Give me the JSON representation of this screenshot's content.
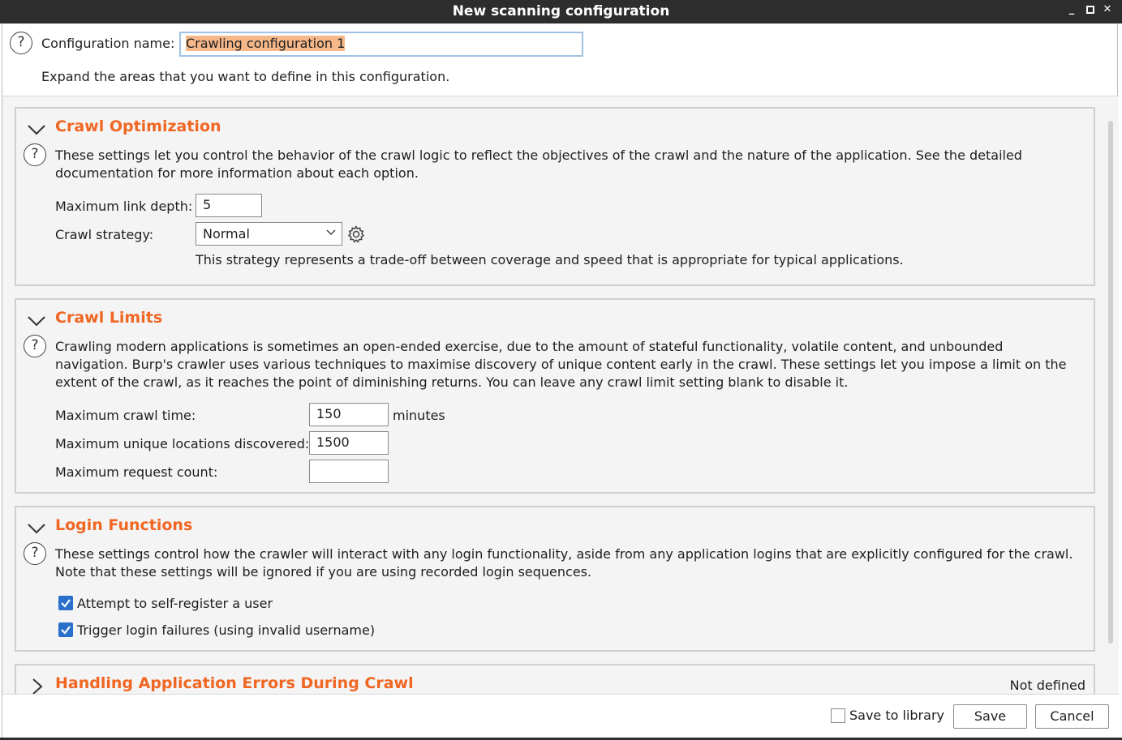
{
  "window": {
    "title": "New scanning configuration",
    "controls": {
      "minimize": "_",
      "maximize": "▫",
      "close": "✕"
    }
  },
  "config_name": {
    "label": "Configuration name:",
    "value": "Crawling configuration 1"
  },
  "intro": "Expand the areas that you want to define in this configuration.",
  "help_glyph": "?",
  "crawl_optimization": {
    "title": "Crawl Optimization",
    "description": "These settings let you control the behavior of the crawl logic to reflect the objectives of the crawl and the nature of the application. See the detailed documentation for more information about each option.",
    "max_link_depth_label": "Maximum link depth:",
    "max_link_depth_value": "5",
    "crawl_strategy_label": "Crawl strategy:",
    "crawl_strategy_value": "Normal",
    "strategy_note": "This strategy represents a trade-off between coverage and speed that is appropriate for typical applications."
  },
  "crawl_limits": {
    "title": "Crawl Limits",
    "description": "Crawling modern applications is sometimes an open-ended exercise, due to the amount of stateful functionality, volatile content, and unbounded navigation. Burp's crawler uses various techniques to maximise discovery of unique content early in the crawl. These settings let you impose a limit on the extent of the crawl, as it reaches the point of diminishing returns. You can leave any crawl limit setting blank to disable it.",
    "max_time_label": "Maximum crawl time:",
    "max_time_value": "150",
    "max_time_unit": "minutes",
    "max_locations_label": "Maximum unique locations discovered:",
    "max_locations_value": "1500",
    "max_requests_label": "Maximum request count:",
    "max_requests_value": ""
  },
  "login_functions": {
    "title": "Login Functions",
    "description": "These settings control how the crawler will interact with any login functionality, aside from any application logins that are explicitly configured for the crawl. Note that these settings will be ignored if you are using recorded login sequences.",
    "options": [
      {
        "label": "Attempt to self-register a user",
        "checked": true
      },
      {
        "label": "Trigger login failures (using invalid username)",
        "checked": true
      }
    ]
  },
  "error_handling": {
    "title": "Handling Application Errors During Crawl",
    "status": "Not defined"
  },
  "footer": {
    "save_to_library_label": "Save to library",
    "save_to_library_checked": false,
    "save_label": "Save",
    "cancel_label": "Cancel"
  },
  "colors": {
    "accent": "#f06623",
    "checkbox": "#2a6fc9",
    "titlebar": "#2d2d2d",
    "selection": "#f7b889"
  }
}
